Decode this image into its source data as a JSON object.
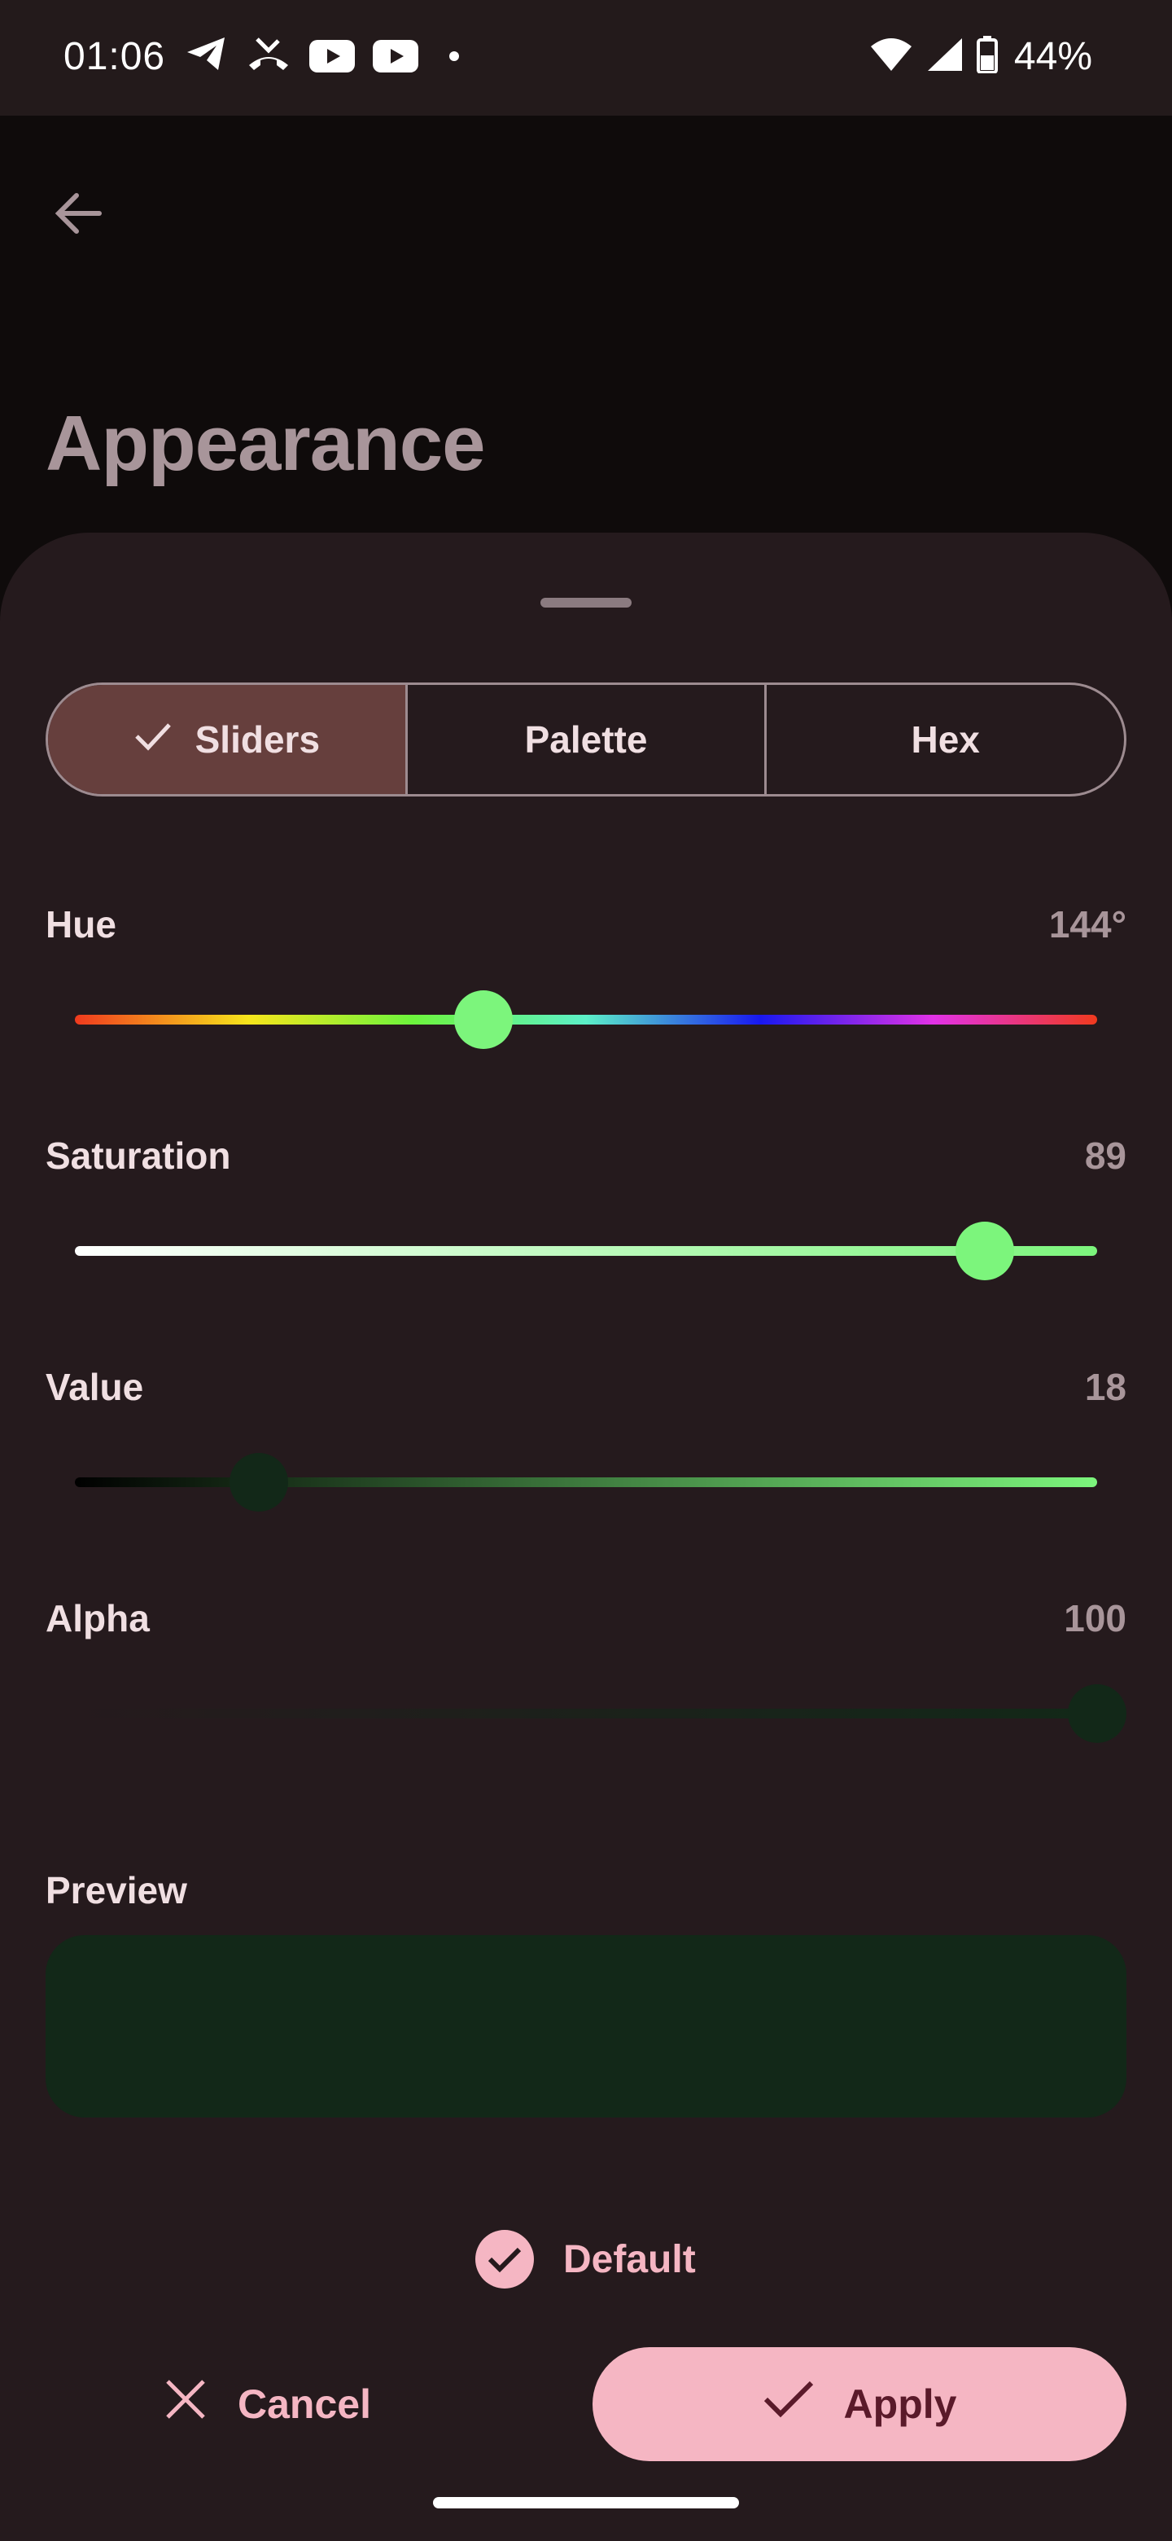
{
  "status_bar": {
    "time": "01:06",
    "left_icons": [
      "telegram-icon",
      "missed-call-icon",
      "youtube-icon",
      "youtube-icon",
      "dot-icon"
    ],
    "right_icons": [
      "wifi-icon",
      "cell-signal-icon",
      "battery-icon"
    ],
    "battery": "44%"
  },
  "header": {
    "back_icon": "arrow-back-icon",
    "title": "Appearance"
  },
  "picker": {
    "tabs": [
      {
        "label": "Sliders",
        "selected": true
      },
      {
        "label": "Palette",
        "selected": false
      },
      {
        "label": "Hex",
        "selected": false
      }
    ],
    "sliders": [
      {
        "label": "Hue",
        "value": "144°",
        "fraction": 0.4
      },
      {
        "label": "Saturation",
        "value": "89",
        "fraction": 0.89
      },
      {
        "label": "Value",
        "value": "18",
        "fraction": 0.18
      },
      {
        "label": "Alpha",
        "value": "100",
        "fraction": 1.0
      }
    ],
    "preview_label": "Preview",
    "preview_color": "#122818",
    "default_label": "Default",
    "default_checked": true,
    "cancel_label": "Cancel",
    "apply_label": "Apply"
  },
  "colors": {
    "accent": "#f5b6c3",
    "sheet_bg": "#251a1d",
    "selected_tab_bg": "#663f3d",
    "thumb_bright": "#7cf57c",
    "thumb_dark": "#122818"
  }
}
